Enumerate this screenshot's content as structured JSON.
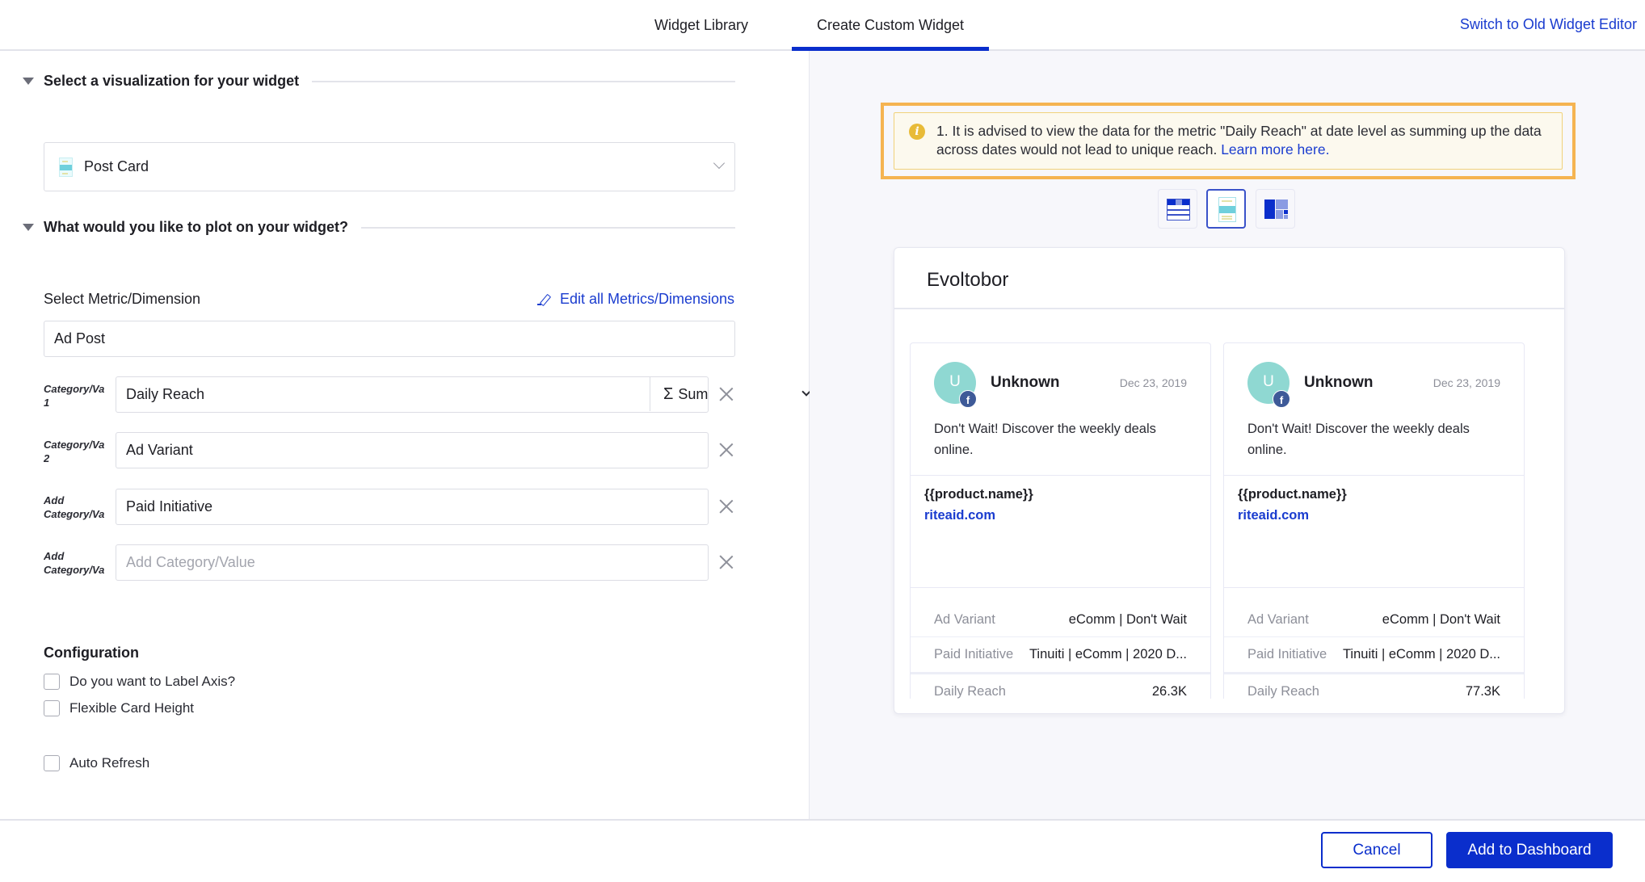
{
  "header": {
    "tabs": [
      {
        "label": "Widget Library",
        "active": false
      },
      {
        "label": "Create Custom Widget",
        "active": true
      }
    ],
    "switch_link": "Switch to Old Widget Editor"
  },
  "left": {
    "viz_section": {
      "title": "Select a visualization for your widget",
      "selected": "Post Card",
      "icon": "post-card-icon"
    },
    "plot_section": {
      "title": "What would you like to plot on your widget?",
      "metric_label": "Select Metric/Dimension",
      "edit_link": "Edit all Metrics/Dimensions",
      "source_value": "Ad Post",
      "rows": [
        {
          "label_line1": "Category/Va",
          "label_line2": "1",
          "value": "Daily Reach",
          "aggregation": "Sum",
          "aggregation_icon": "sigma-icon"
        },
        {
          "label_line1": "Category/Va",
          "label_line2": "2",
          "value": "Ad Variant"
        },
        {
          "label_line1": "Add",
          "label_line2": "Category/Va",
          "value": "Paid Initiative"
        },
        {
          "label_line1": "Add",
          "label_line2": "Category/Va",
          "value": "",
          "placeholder": "Add Category/Value"
        }
      ]
    },
    "configuration": {
      "title": "Configuration",
      "options": [
        {
          "label": "Do you want to Label Axis?",
          "checked": false
        },
        {
          "label": "Flexible Card Height",
          "checked": false
        },
        {
          "label": "Auto Refresh",
          "checked": false
        }
      ]
    }
  },
  "right": {
    "banner": {
      "icon": "info-icon",
      "text": "1. It is advised to view the data for the metric \"Daily Reach\" at date level as summing up the data across dates would not lead to unique reach.",
      "link": "Learn more here.",
      "highlight_color": "#f5b451"
    },
    "view_options": [
      {
        "name": "table-view",
        "active": false
      },
      {
        "name": "post-card-view",
        "active": true
      },
      {
        "name": "treemap-view",
        "active": false
      }
    ],
    "preview": {
      "title": "Evoltobor",
      "cards": [
        {
          "avatar_letter": "U",
          "network": "f",
          "author": "Unknown",
          "date": "Dec 23, 2019",
          "message": "Don't Wait! Discover the weekly deals online.",
          "product": "{{product.name}}",
          "url": "riteaid.com",
          "meta": [
            {
              "key": "Ad Variant",
              "value": "eComm | Don't Wait"
            },
            {
              "key": "Paid Initiative",
              "value": "Tinuiti | eComm | 2020 D..."
            },
            {
              "key": "Daily Reach",
              "value": "26.3K"
            }
          ]
        },
        {
          "avatar_letter": "U",
          "network": "f",
          "author": "Unknown",
          "date": "Dec 23, 2019",
          "message": "Don't Wait! Discover the weekly deals online.",
          "product": "{{product.name}}",
          "url": "riteaid.com",
          "meta": [
            {
              "key": "Ad Variant",
              "value": "eComm | Don't Wait"
            },
            {
              "key": "Paid Initiative",
              "value": "Tinuiti | eComm | 2020 D..."
            },
            {
              "key": "Daily Reach",
              "value": "77.3K"
            }
          ]
        }
      ]
    }
  },
  "footer": {
    "cancel": "Cancel",
    "add": "Add to Dashboard"
  },
  "colors": {
    "primary": "#0a2ecc",
    "link": "#1a3ccf",
    "warning_bg": "#fcf9ee",
    "warning_icon": "#e8bb38",
    "avatar": "#8fd8d2",
    "facebook": "#3e5a98"
  }
}
